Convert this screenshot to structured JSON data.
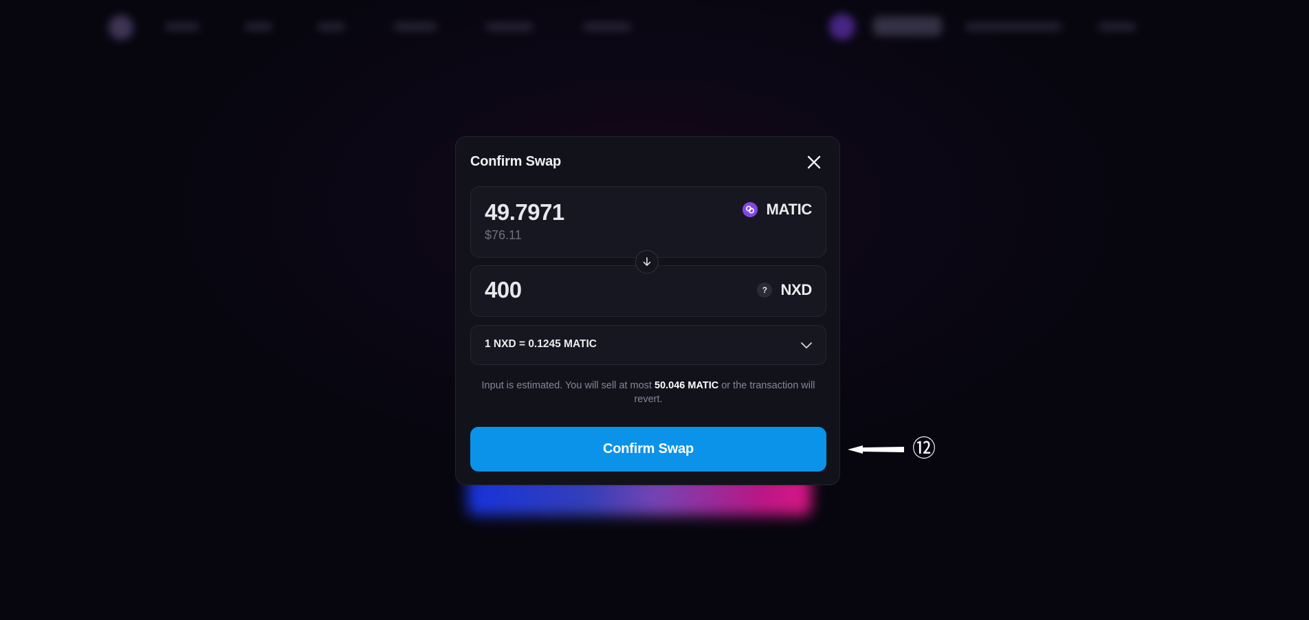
{
  "modal": {
    "title": "Confirm Swap",
    "input": {
      "amount": "49.7971",
      "usd_value": "$76.11",
      "token": "MATIC",
      "icon": "matic-token-icon"
    },
    "output": {
      "amount": "400",
      "token": "NXD",
      "icon_glyph": "?",
      "icon": "unknown-token-icon"
    },
    "rate": "1 NXD = 0.1245 MATIC",
    "disclaimer": {
      "before": "Input is estimated. You will sell at most ",
      "highlight": "50.046 MATIC",
      "after": " or the transaction will revert."
    },
    "confirm_label": "Confirm Swap",
    "close_icon": "close-icon",
    "arrow_icon": "arrow-down-icon",
    "chevron_icon": "chevron-down-icon"
  },
  "annotation": {
    "number": "⑫",
    "icon": "pointer-arrow-icon"
  },
  "colors": {
    "accent": "#0b93ea",
    "matic": "#8247e5",
    "modal_bg": "#12131a",
    "page_bg": "#07060f"
  }
}
